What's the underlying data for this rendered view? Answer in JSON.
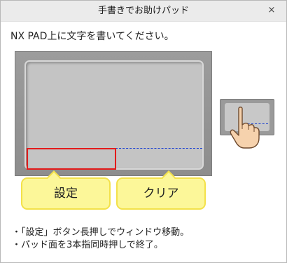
{
  "window": {
    "title": "手書きでお助けパッド",
    "close_glyph": "×"
  },
  "instruction": "NX PAD上に文字を書いてください。",
  "callouts": {
    "settings": "設定",
    "clear": "クリア"
  },
  "notes": [
    "・「設定」ボタン長押しでウィンドウ移動。",
    "・パッド面を3本指同時押しで終了。"
  ],
  "colors": {
    "settings_zone_border": "#e31b1b",
    "dash_line": "#1a3fd0",
    "callout_fill": "#fcf799"
  }
}
